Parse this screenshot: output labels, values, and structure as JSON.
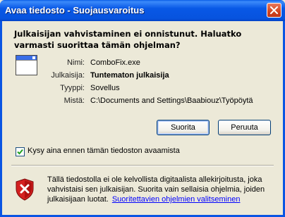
{
  "window": {
    "title": "Avaa tiedosto - Suojausvaroitus"
  },
  "heading": "Julkaisijan vahvistaminen ei onnistunut. Haluatko varmasti suorittaa tämän ohjelman?",
  "details": [
    {
      "label": "Nimi:",
      "value": "ComboFix.exe",
      "bold": false
    },
    {
      "label": "Julkaisija:",
      "value": "Tuntematon julkaisija",
      "bold": true
    },
    {
      "label": "Tyyppi:",
      "value": "Sovellus",
      "bold": false
    },
    {
      "label": "Mistä:",
      "value": "C:\\Documents and Settings\\Baabiouz\\Työpöytä",
      "bold": false
    }
  ],
  "buttons": {
    "run": "Suorita",
    "cancel": "Peruuta"
  },
  "checkbox": {
    "label": "Kysy aina ennen tämän tiedoston avaamista",
    "checked": true
  },
  "warning": {
    "text": "Tällä tiedostolla ei ole kelvollista digitaalista allekirjoitusta, joka vahvistaisi sen julkaisijan. Suorita vain sellaisia ohjelmia, joiden julkaisijaan luotat.",
    "link": "Suoritettavien ohjelmien valitseminen"
  },
  "colors": {
    "titlebar": "#0858e6",
    "shield": "#cc1111",
    "link": "#0000ff"
  }
}
